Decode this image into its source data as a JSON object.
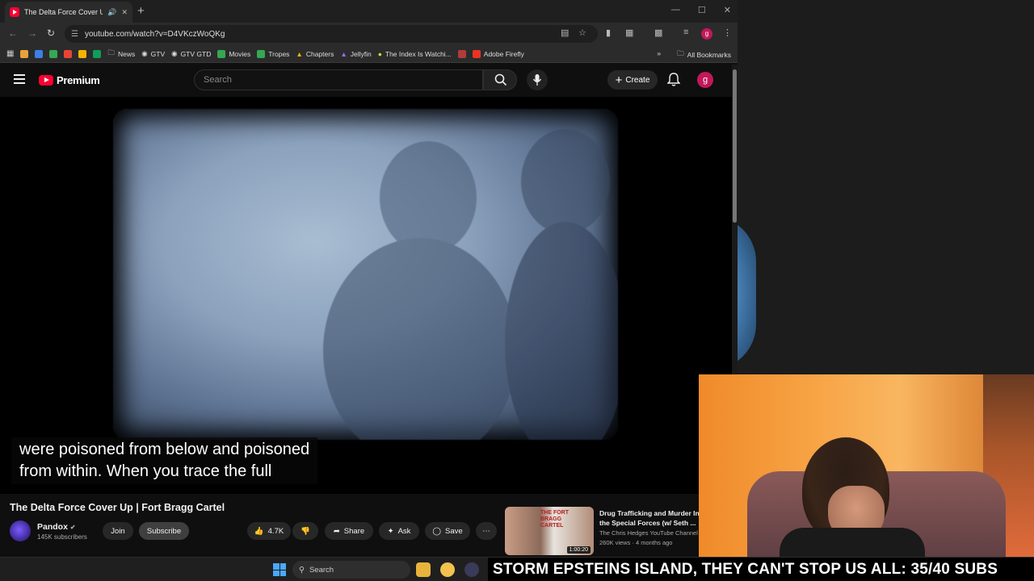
{
  "browser": {
    "tab_title": "The Delta Force Cover Up |",
    "url": "youtube.com/watch?v=D4VKczWoQKg",
    "bookmarks": [
      "News",
      "GTV",
      "GTV GTD",
      "Movies",
      "Tropes",
      "Chapters",
      "Jellyfin",
      "The Index Is Watchi...",
      "Adobe Firefly"
    ],
    "all_bookmarks": "All Bookmarks"
  },
  "youtube": {
    "logo_text": "Premium",
    "search_placeholder": "Search",
    "create_label": "Create",
    "avatar_letter": "g"
  },
  "video": {
    "caption_line1": "were poisoned from below and poisoned",
    "caption_line2": "from within. When you trace the full",
    "title": "The Delta Force Cover Up | Fort Bragg Cartel",
    "channel": "Pandox",
    "subscribers": "145K subscribers",
    "join_label": "Join",
    "subscribe_label": "Subscribe",
    "likes": "4.7K",
    "share_label": "Share",
    "ask_label": "Ask",
    "save_label": "Save"
  },
  "recommendation": {
    "title": "Drug Trafficking and Murder In the Special Forces (w/ Seth ...",
    "channel": "The Chris Hedges YouTube Channel",
    "meta": "260K views · 4 months ago",
    "duration": "1:00:20",
    "thumb_text": "THE FORT BRAGG CARTEL"
  },
  "taskbar": {
    "search_label": "Search",
    "ticker": "STORM EPSTEINS ISLAND, THEY CAN'T STOP US ALL: 35/40 SUBS"
  },
  "colors": {
    "youtube_red": "#ff0033",
    "avatar": "#c2185b",
    "windows_blue": "#4aa8ff"
  }
}
